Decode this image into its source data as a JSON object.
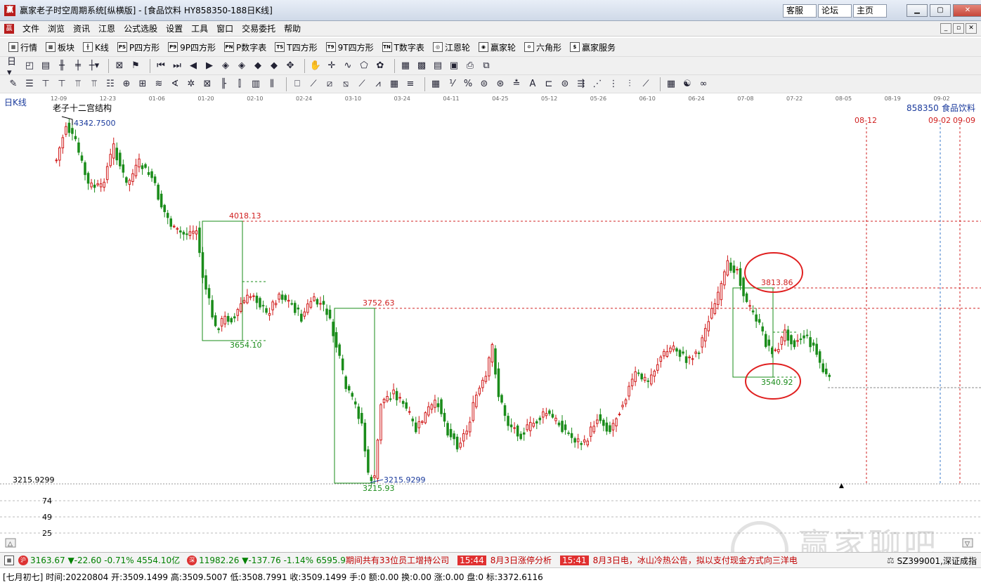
{
  "window": {
    "title": "赢家老子时空周期系统[纵横版] - [食品饮料   HY858350-188日K线]",
    "links": [
      "客服",
      "论坛",
      "主页"
    ],
    "min_label": "▁",
    "max_label": "▢",
    "close_label": "✕"
  },
  "menu": [
    "文件",
    "浏览",
    "资讯",
    "江恩",
    "公式选股",
    "设置",
    "工具",
    "窗口",
    "交易委托",
    "帮助"
  ],
  "toolbar1": [
    {
      "icon": "table-icon",
      "glyph": "▦",
      "label": "行情"
    },
    {
      "icon": "blocks-icon",
      "glyph": "▩",
      "label": "板块"
    },
    {
      "icon": "candle-icon",
      "glyph": "╫",
      "label": "K线"
    },
    {
      "icon": "ps-icon",
      "glyph": "PS",
      "label": "P四方形"
    },
    {
      "icon": "p9-icon",
      "glyph": "P9",
      "label": "9P四方形"
    },
    {
      "icon": "pn-icon",
      "glyph": "PN",
      "label": "P数字表"
    },
    {
      "icon": "ts-icon",
      "glyph": "TS",
      "label": "T四方形"
    },
    {
      "icon": "t9-icon",
      "glyph": "T9",
      "label": "9T四方形"
    },
    {
      "icon": "tn-icon",
      "glyph": "TN",
      "label": "T数字表"
    },
    {
      "icon": "gann-wheel-icon",
      "glyph": "◎",
      "label": "江恩轮"
    },
    {
      "icon": "winner-wheel-icon",
      "glyph": "◉",
      "label": "赢家轮"
    },
    {
      "icon": "hexagon-icon",
      "glyph": "✡",
      "label": "六角形"
    },
    {
      "icon": "service-icon",
      "glyph": "$",
      "label": "赢家服务"
    }
  ],
  "chart": {
    "period_label": "日K线",
    "structure_label": "老子十二宫结构",
    "code": "858350",
    "name": "食品饮料",
    "date_ticks": [
      "12-09",
      "12-23",
      "01-06",
      "01-20",
      "02-10",
      "02-24",
      "03-10",
      "03-24",
      "04-11",
      "04-25",
      "05-12",
      "05-26",
      "06-10",
      "06-24",
      "07-08",
      "07-22",
      "08-05",
      "08-19",
      "09-02"
    ],
    "vline_labels": [
      "08-12",
      "09-02",
      "09-09"
    ],
    "high_label": "4342.7500",
    "low_label": "3215.9299",
    "low_box_label": "3215.93",
    "axis_low_label": "3215.9299",
    "levels": [
      "4018.13",
      "3752.63",
      "3813.86"
    ],
    "box_low_labels": [
      "3654.10",
      "3540.92"
    ],
    "indicator_ticks": [
      "74",
      "49",
      "25"
    ],
    "colors": {
      "up": "#d01818",
      "down": "#1a8c1a",
      "level": "#d02020",
      "box": "#1a8c1a",
      "vline": "#d02020",
      "vline_blue": "#3a78c8"
    }
  },
  "status": {
    "sh_value": "3163.67",
    "sh_change": "▼-22.60",
    "sh_pct": "-0.71%",
    "sh_amount": "4554.10亿",
    "sz_value": "11982.26",
    "sz_change": "▼-137.76",
    "sz_pct": "-1.14%",
    "sz_amount": "6595.9",
    "news_lead": "期间共有33位员工增持公司",
    "news": [
      {
        "time": "15:44",
        "text": "8月3日涨停分析"
      },
      {
        "time": "15:41",
        "text": "8月3日电，冰山冷热公告，拟以支付现金方式向三洋电"
      }
    ],
    "right_status": "SZ399001,深证成指"
  },
  "bottom_info": "[七月初七] 时间:20220804 开:3509.1499 高:3509.5007 低:3508.7991 收:3509.1499 手:0 额:0.00 换:0.00 涨:0.00 盘:0 标:3372.6116",
  "watermark": {
    "text": "赢家聊吧",
    "url": "liaoba.yjcf360.com"
  }
}
